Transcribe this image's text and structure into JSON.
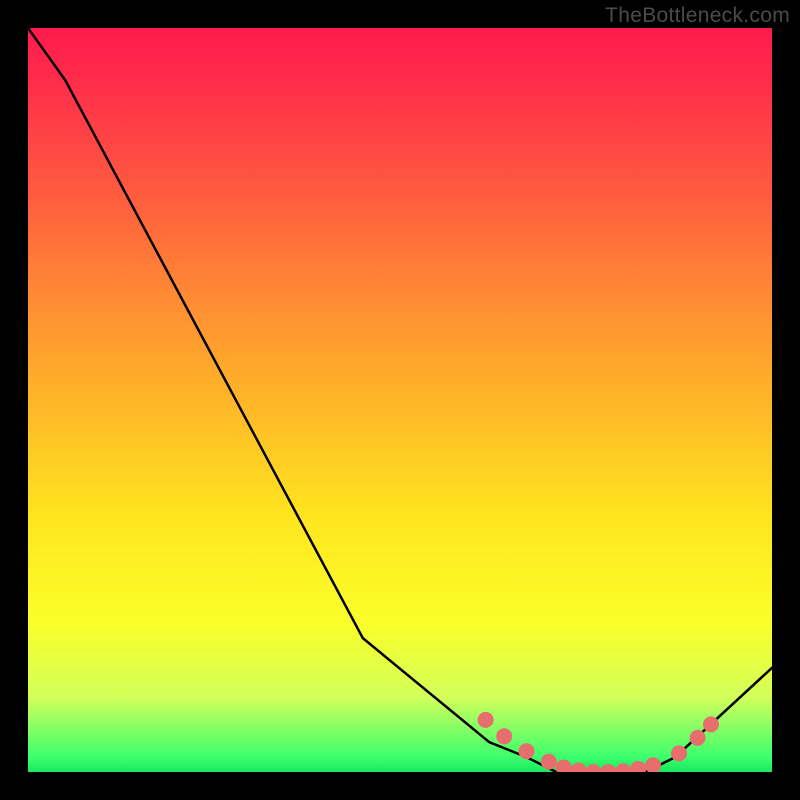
{
  "watermark": {
    "text": "TheBottleneck.com"
  },
  "chart_data": {
    "type": "line",
    "title": "",
    "xlabel": "",
    "ylabel": "",
    "x": [
      0.0,
      0.05,
      0.45,
      0.62,
      0.67,
      0.71,
      0.75,
      0.79,
      0.83,
      0.87,
      1.0
    ],
    "values": [
      1.0,
      0.93,
      0.18,
      0.04,
      0.02,
      0.0,
      0.0,
      0.0,
      0.0,
      0.02,
      0.14
    ],
    "xlim": [
      0,
      1
    ],
    "ylim": [
      0,
      1
    ],
    "markers": {
      "values": [
        {
          "x": 0.615,
          "y": 0.07
        },
        {
          "x": 0.64,
          "y": 0.048
        },
        {
          "x": 0.67,
          "y": 0.028
        },
        {
          "x": 0.7,
          "y": 0.014
        },
        {
          "x": 0.72,
          "y": 0.006
        },
        {
          "x": 0.74,
          "y": 0.002
        },
        {
          "x": 0.76,
          "y": 0.0
        },
        {
          "x": 0.78,
          "y": 0.0
        },
        {
          "x": 0.8,
          "y": 0.001
        },
        {
          "x": 0.82,
          "y": 0.004
        },
        {
          "x": 0.84,
          "y": 0.009
        },
        {
          "x": 0.875,
          "y": 0.025
        },
        {
          "x": 0.9,
          "y": 0.046
        },
        {
          "x": 0.918,
          "y": 0.064
        }
      ]
    },
    "colors": {
      "gradient_top": "#ff1a4d",
      "gradient_mid": "#ffe61f",
      "gradient_bottom": "#18e85c",
      "curve": "#000000",
      "markers": "#e86d6d",
      "frame": "#000000"
    }
  }
}
